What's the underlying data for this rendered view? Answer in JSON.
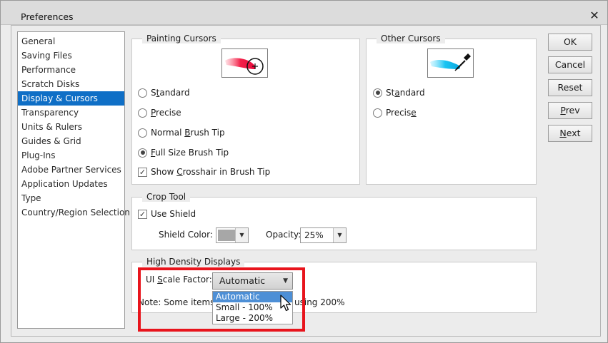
{
  "window": {
    "title": "Preferences"
  },
  "sidebar": {
    "items": [
      {
        "label": "General",
        "selected": false
      },
      {
        "label": "Saving Files",
        "selected": false
      },
      {
        "label": "Performance",
        "selected": false
      },
      {
        "label": "Scratch Disks",
        "selected": false
      },
      {
        "label": "Display & Cursors",
        "selected": true
      },
      {
        "label": "Transparency",
        "selected": false
      },
      {
        "label": "Units & Rulers",
        "selected": false
      },
      {
        "label": "Guides & Grid",
        "selected": false
      },
      {
        "label": "Plug-Ins",
        "selected": false
      },
      {
        "label": "Adobe Partner Services",
        "selected": false
      },
      {
        "label": "Application Updates",
        "selected": false
      },
      {
        "label": "Type",
        "selected": false
      },
      {
        "label": "Country/Region Selection",
        "selected": false
      }
    ]
  },
  "painting_cursors": {
    "title": "Painting Cursors",
    "standard": {
      "prefix": "S",
      "key": "t",
      "rest": "andard"
    },
    "precise": {
      "key": "P",
      "rest": "recise"
    },
    "normal_brush": {
      "prefix": "Normal ",
      "key": "B",
      "rest": "rush Tip"
    },
    "full_size": {
      "key": "F",
      "rest": "ull Size Brush Tip"
    },
    "crosshair": {
      "prefix": "Show ",
      "key": "C",
      "rest": "rosshair in Brush Tip"
    },
    "selected": "full_size",
    "crosshair_checked": true
  },
  "other_cursors": {
    "title": "Other Cursors",
    "standard": {
      "prefix": "St",
      "key": "a",
      "rest": "ndard"
    },
    "precise": {
      "prefix": "Precis",
      "key": "e",
      "rest": ""
    },
    "selected": "standard"
  },
  "crop_tool": {
    "title": "Crop Tool",
    "use_shield": "Use Shield",
    "use_shield_checked": true,
    "shield_color_label": "Shield Color:",
    "shield_color": "#a7a7a7",
    "opacity_label": "Opacity:",
    "opacity_value": "25%"
  },
  "high_density": {
    "title": "High Density Displays",
    "scale_label_prefix": "UI ",
    "scale_label_key": "S",
    "scale_label_rest": "cale Factor:",
    "scale_value": "Automatic",
    "note_left": "Note: Some items",
    "note_right": "using 200%",
    "options": [
      "Automatic",
      "Small - 100%",
      "Large - 200%"
    ],
    "highlighted_option": 0
  },
  "buttons": {
    "ok": "OK",
    "cancel": "Cancel",
    "reset": "Reset",
    "prev_key": "P",
    "prev_rest": "rev",
    "next_key": "N",
    "next_rest": "ext"
  },
  "colors": {
    "selection": "#0f6fc6",
    "highlight_annotation": "#e8141c",
    "dropdown_highlight": "#4d8fd6"
  }
}
